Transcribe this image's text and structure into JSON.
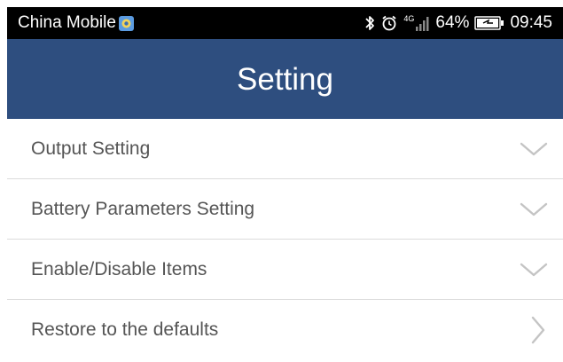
{
  "status_bar": {
    "carrier": "China Mobile",
    "network_type": "4G",
    "battery_percent": "64%",
    "time": "09:45",
    "icons": [
      "carrier-app-icon",
      "bluetooth-icon",
      "alarm-icon",
      "signal-icon",
      "battery-icon"
    ]
  },
  "header": {
    "title": "Setting",
    "background_color": "#2e4e7f"
  },
  "settings": {
    "items": [
      {
        "label": "Output Setting",
        "chevron": "chevron-down-icon"
      },
      {
        "label": "Battery Parameters Setting",
        "chevron": "chevron-down-icon"
      },
      {
        "label": "Enable/Disable Items",
        "chevron": "chevron-down-icon"
      },
      {
        "label": "Restore to the defaults",
        "chevron": "chevron-right-icon"
      }
    ]
  }
}
